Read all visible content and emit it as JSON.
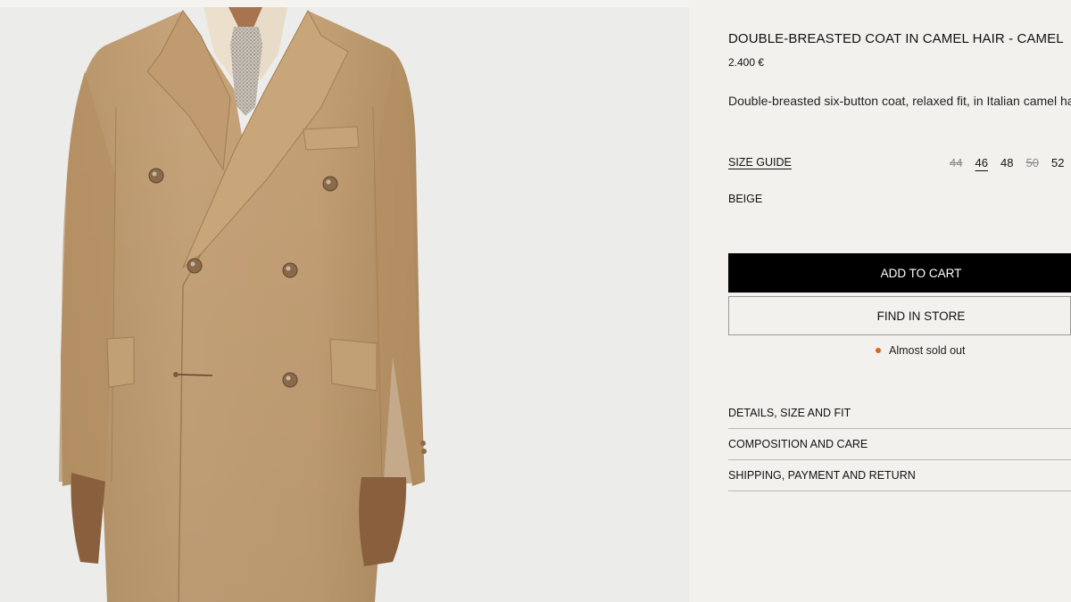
{
  "product": {
    "title": "DOUBLE-BREASTED COAT IN CAMEL HAIR - CAMEL",
    "price": "2.400 €",
    "description": "Double-breasted six-button coat, relaxed fit, in Italian camel hair.",
    "size_guide_label": "SIZE GUIDE",
    "sizes": [
      {
        "label": "44",
        "available": false,
        "selected": false
      },
      {
        "label": "46",
        "available": true,
        "selected": true
      },
      {
        "label": "48",
        "available": true,
        "selected": false
      },
      {
        "label": "50",
        "available": false,
        "selected": false
      },
      {
        "label": "52",
        "available": true,
        "selected": false
      }
    ],
    "color_label": "BEIGE",
    "add_to_cart_label": "ADD TO CART",
    "find_in_store_label": "FIND IN STORE",
    "stock_status": "Almost sold out",
    "stock_color": "#d2691e",
    "accordion": [
      {
        "label": "DETAILS, SIZE AND FIT"
      },
      {
        "label": "COMPOSITION AND CARE"
      },
      {
        "label": "SHIPPING, PAYMENT AND RETURN"
      }
    ]
  },
  "image": {
    "subject": "camel-coat-photo"
  }
}
